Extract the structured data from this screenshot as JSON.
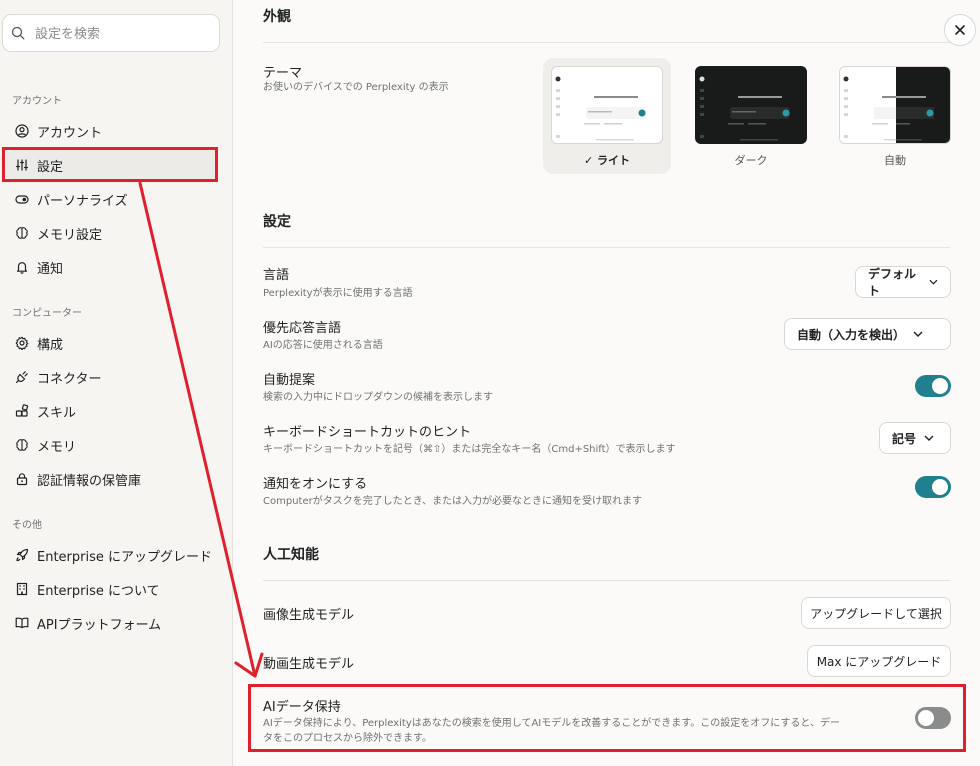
{
  "sidebar": {
    "search_placeholder": "設定を検索",
    "sections": [
      {
        "label": "アカウント"
      },
      {
        "label": "コンピューター"
      },
      {
        "label": "その他"
      }
    ],
    "items": [
      {
        "label": "アカウント",
        "icon": "user-circle-icon"
      },
      {
        "label": "設定",
        "icon": "sliders-icon",
        "active": true
      },
      {
        "label": "パーソナライズ",
        "icon": "toggle-icon"
      },
      {
        "label": "メモリ設定",
        "icon": "brain-icon"
      },
      {
        "label": "通知",
        "icon": "bell-icon"
      },
      {
        "label": "構成",
        "icon": "gear-icon"
      },
      {
        "label": "コネクター",
        "icon": "plug-icon"
      },
      {
        "label": "スキル",
        "icon": "blocks-icon"
      },
      {
        "label": "メモリ",
        "icon": "brain-icon"
      },
      {
        "label": "認証情報の保管庫",
        "icon": "lock-icon"
      },
      {
        "label": "Enterprise にアップグレード",
        "icon": "rocket-icon"
      },
      {
        "label": "Enterprise について",
        "icon": "building-icon"
      },
      {
        "label": "APIプラットフォーム",
        "icon": "book-icon"
      }
    ]
  },
  "main": {
    "appearance": {
      "title": "外観",
      "theme_label": "テーマ",
      "theme_desc": "お使いのデバイスでの Perplexity の表示",
      "themes": [
        {
          "label": "ライト",
          "selected": true
        },
        {
          "label": "ダーク",
          "selected": false
        },
        {
          "label": "自動",
          "selected": false
        }
      ]
    },
    "settings": {
      "title": "設定",
      "rows": [
        {
          "label": "言語",
          "desc": "Perplexityが表示に使用する言語",
          "control": "dropdown",
          "value": "デフォルト"
        },
        {
          "label": "優先応答言語",
          "desc": "AIの応答に使用される言語",
          "control": "dropdown",
          "value": "自動（入力を検出）"
        },
        {
          "label": "自動提案",
          "desc": "検索の入力中にドロップダウンの候補を表示します",
          "control": "toggle",
          "on": true
        },
        {
          "label": "キーボードショートカットのヒント",
          "desc": "キーボードショートカットを記号（⌘⇧）または完全なキー名（Cmd+Shift）で表示します",
          "control": "dropdown",
          "value": "記号"
        },
        {
          "label": "通知をオンにする",
          "desc": "Computerがタスクを完了したとき、または入力が必要なときに通知を受け取れます",
          "control": "toggle",
          "on": true
        }
      ]
    },
    "ai": {
      "title": "人工知能",
      "rows": [
        {
          "label": "画像生成モデル",
          "control": "button",
          "value": "アップグレードして選択"
        },
        {
          "label": "動画生成モデル",
          "control": "button",
          "value": "Max にアップグレード"
        },
        {
          "label": "AIデータ保持",
          "desc": "AIデータ保持により、Perplexityはあなたの検索を使用してAIモデルを改善することができます。この設定をオフにすると、データをこのプロセスから除外できます。",
          "control": "toggle",
          "on": false
        }
      ]
    }
  },
  "colors": {
    "accent": "#20808d",
    "annotation": "#e0202d",
    "toggle_off": "#8a8c8b"
  }
}
